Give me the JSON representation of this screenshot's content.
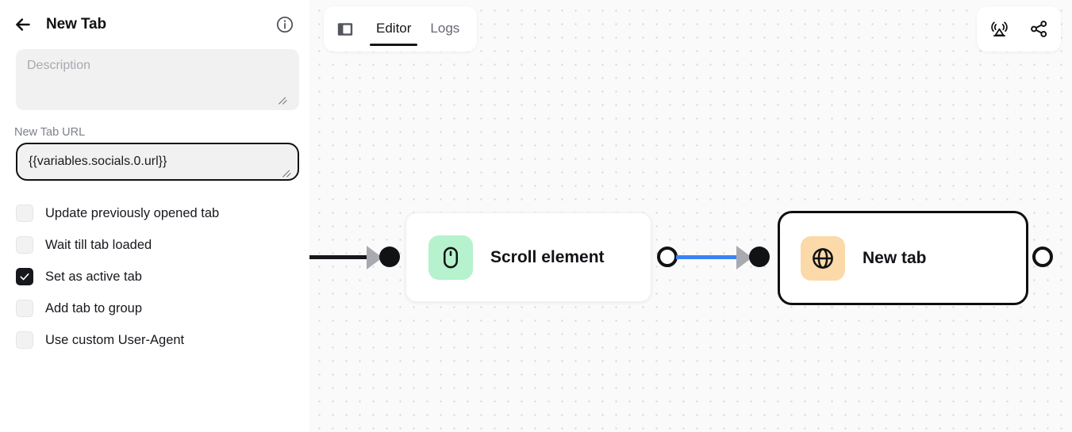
{
  "panel": {
    "back_icon": "arrow-left-icon",
    "title": "New Tab",
    "info_icon": "info-circle-icon",
    "description": {
      "value": "",
      "placeholder": "Description"
    },
    "url_field": {
      "label": "New Tab URL",
      "value": "{{variables.socials.0.url}}",
      "placeholder": ""
    },
    "checkboxes": [
      {
        "label": "Update previously opened tab",
        "checked": false
      },
      {
        "label": "Wait till tab loaded",
        "checked": false
      },
      {
        "label": "Set as active tab",
        "checked": true
      },
      {
        "label": "Add tab to group",
        "checked": false
      },
      {
        "label": "Use custom User-Agent",
        "checked": false
      }
    ]
  },
  "toolbar": {
    "sidebar_toggle_icon": "panel-toggle-icon",
    "tabs": [
      {
        "label": "Editor",
        "active": true
      },
      {
        "label": "Logs",
        "active": false
      }
    ],
    "actions": [
      {
        "icon": "broadcast-icon"
      },
      {
        "icon": "share-icon"
      }
    ]
  },
  "canvas": {
    "nodes": [
      {
        "label": "Scroll element",
        "icon": "mouse-icon",
        "icon_color": "#b5f2cd",
        "selected": false
      },
      {
        "label": "New tab",
        "icon": "globe-icon",
        "icon_color": "#fbd9a8",
        "selected": true
      }
    ],
    "edge_color": "#3b82f6",
    "incoming_edge_color": "#16171b"
  }
}
